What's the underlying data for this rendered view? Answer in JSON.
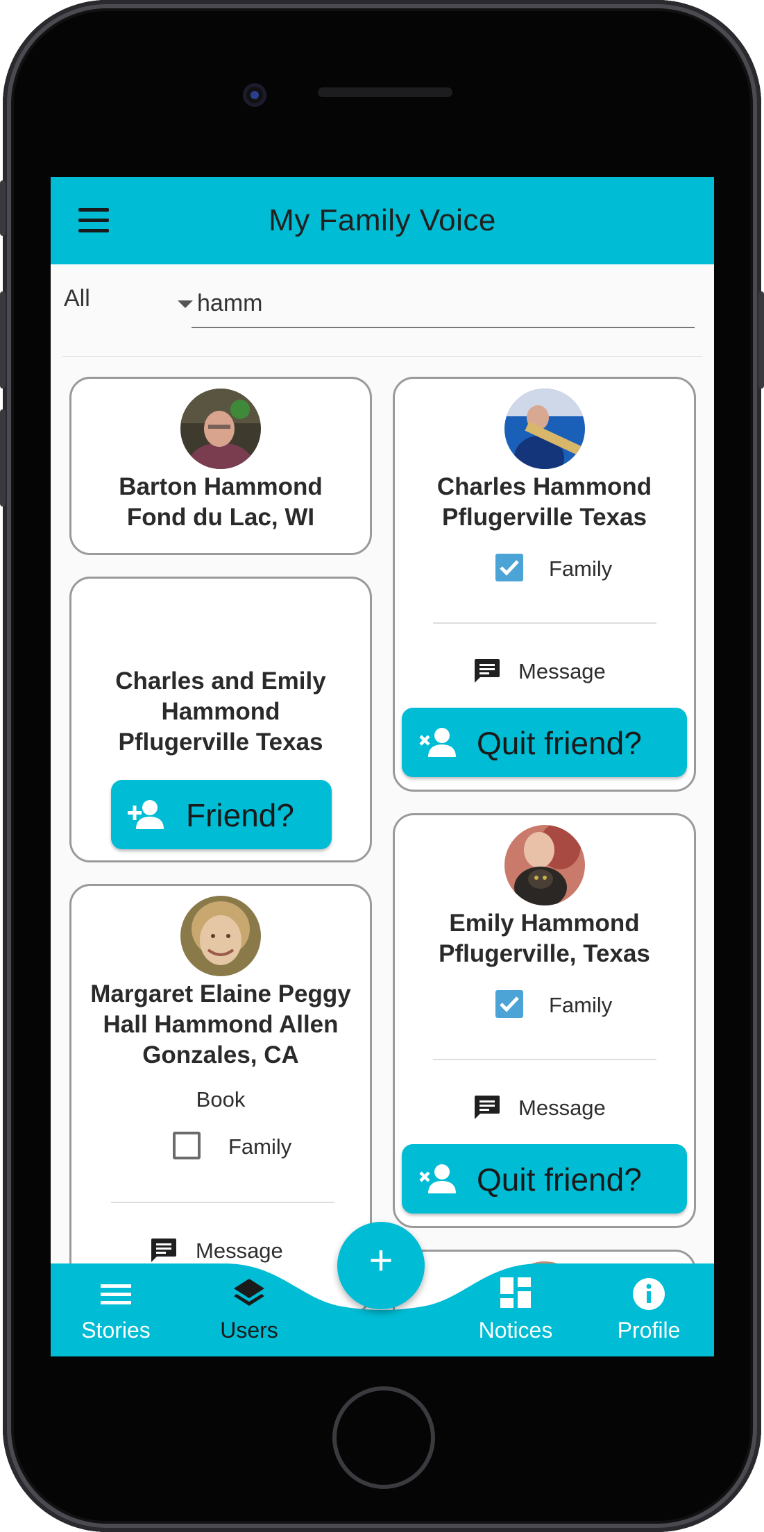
{
  "app": {
    "title": "My Family Voice"
  },
  "filter": {
    "selected": "All"
  },
  "search": {
    "value": "hamm"
  },
  "cards": {
    "barton": {
      "name": "Barton Hammond\nFond du Lac, WI"
    },
    "charles": {
      "name": "Charles Hammond\nPflugerville Texas",
      "family_label": "Family",
      "family_checked": true,
      "message_label": "Message",
      "action_label": "Quit friend?"
    },
    "charles_emily": {
      "name": "Charles and Emily Hammond\nPflugerville Texas",
      "action_label": "Friend?"
    },
    "emily": {
      "name": "Emily Hammond\nPflugerville, Texas",
      "family_label": "Family",
      "family_checked": true,
      "message_label": "Message",
      "action_label": "Quit friend?"
    },
    "margaret": {
      "name": "Margaret Elaine Peggy Hall Hammond Allen\nGonzales, CA",
      "book_label": "Book",
      "family_label": "Family",
      "family_checked": false,
      "message_label": "Message"
    }
  },
  "nav": {
    "stories": "Stories",
    "users": "Users",
    "notices": "Notices",
    "profile": "Profile"
  },
  "colors": {
    "primary": "#00bcd4",
    "checkbox": "#4ba3d6",
    "nav_active": "#1a1a1a",
    "nav_inactive": "#ffffff"
  },
  "icons": [
    "menu-icon",
    "dropdown-caret-icon",
    "check-icon",
    "message-icon",
    "person-remove-icon",
    "person-add-icon",
    "stories-icon",
    "users-icon",
    "notices-icon",
    "profile-icon",
    "plus-icon"
  ]
}
